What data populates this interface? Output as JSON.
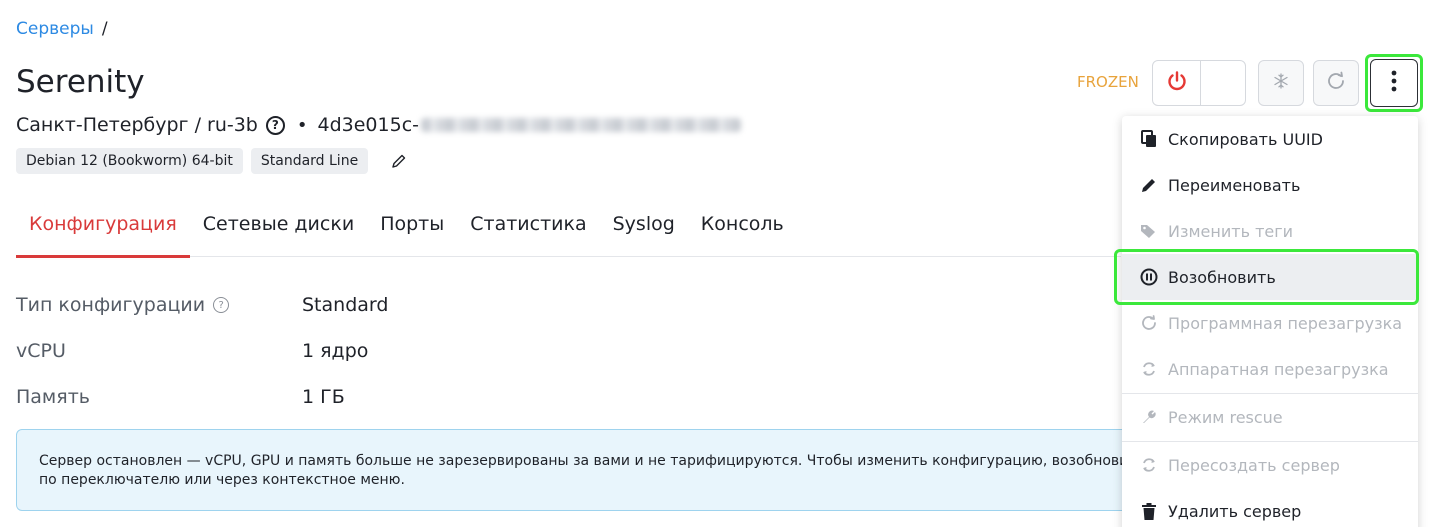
{
  "breadcrumb": {
    "link": "Серверы",
    "separator": "/"
  },
  "server": {
    "name": "Serenity",
    "location": "Санкт-Петербург / ru-3b",
    "help_glyph": "?",
    "bullet": "•",
    "uuid_prefix": "4d3e015c-",
    "tags": [
      "Debian 12 (Bookworm) 64-bit",
      "Standard Line"
    ],
    "status": "FROZEN"
  },
  "tabs": [
    {
      "label": "Конфигурация",
      "active": true
    },
    {
      "label": "Сетевые диски",
      "active": false
    },
    {
      "label": "Порты",
      "active": false
    },
    {
      "label": "Статистика",
      "active": false
    },
    {
      "label": "Syslog",
      "active": false
    },
    {
      "label": "Консоль",
      "active": false
    }
  ],
  "config": [
    {
      "label": "Тип конфигурации",
      "value": "Standard",
      "help": true
    },
    {
      "label": "vCPU",
      "value": "1 ядро",
      "help": false
    },
    {
      "label": "Память",
      "value": "1 ГБ",
      "help": false
    }
  ],
  "alert": {
    "line1": "Сервер остановлен — vCPU, GPU и память больше не зарезервированы за вами и не тарифицируются. Чтобы изменить конфигурацию, возобновит",
    "line2": "по переключателю или через контекстное меню."
  },
  "menu": [
    {
      "label": "Скопировать UUID",
      "icon": "copy-icon",
      "disabled": false
    },
    {
      "label": "Переименовать",
      "icon": "pencil-icon",
      "disabled": false
    },
    {
      "label": "Изменить теги",
      "icon": "tag-icon",
      "disabled": true
    },
    {
      "label": "Возобновить",
      "icon": "pause-circle-icon",
      "disabled": false
    },
    {
      "label": "Программная перезагрузка",
      "icon": "soft-reboot-icon",
      "disabled": true
    },
    {
      "label": "Аппаратная перезагрузка",
      "icon": "hard-reboot-icon",
      "disabled": true
    },
    {
      "label": "Режим rescue",
      "icon": "wrench-icon",
      "disabled": true
    },
    {
      "label": "Пересоздать сервер",
      "icon": "recreate-icon",
      "disabled": true
    },
    {
      "label": "Удалить сервер",
      "icon": "trash-icon",
      "disabled": false
    }
  ],
  "colors": {
    "accent": "#2d8ae3",
    "active_tab": "#d93a3a",
    "status": "#e8a33b",
    "power": "#e53935",
    "highlight": "#3be83b",
    "disabled": "#b3b7bd"
  }
}
